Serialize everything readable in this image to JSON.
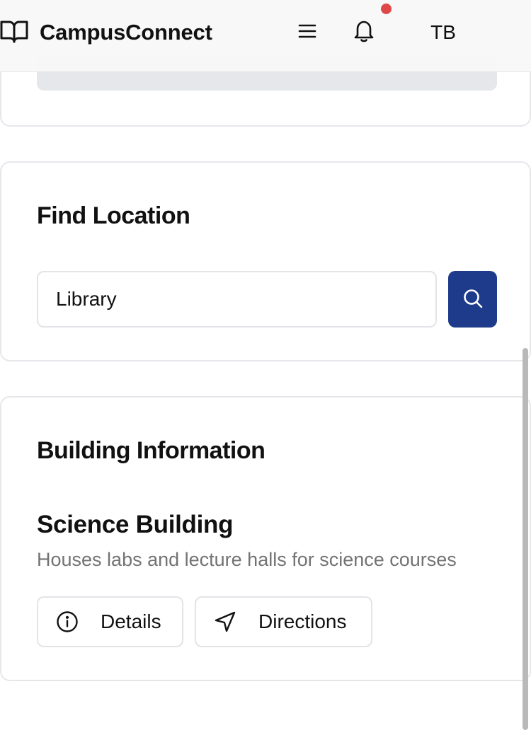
{
  "header": {
    "brand_name": "CampusConnect",
    "avatar_initials": "TB",
    "notification_color": "#e04848",
    "icons": [
      "book-open-icon",
      "menu-icon",
      "bell-icon"
    ]
  },
  "find_location": {
    "title": "Find Location",
    "search_value": "Library",
    "search_icon": "search-icon",
    "button_color": "#1e3a8a"
  },
  "building_info": {
    "title": "Building Information",
    "name": "Science Building",
    "description": "Houses labs and lecture halls for science courses",
    "details_label": "Details",
    "details_icon": "info-icon",
    "directions_label": "Directions",
    "directions_icon": "navigation-icon"
  }
}
